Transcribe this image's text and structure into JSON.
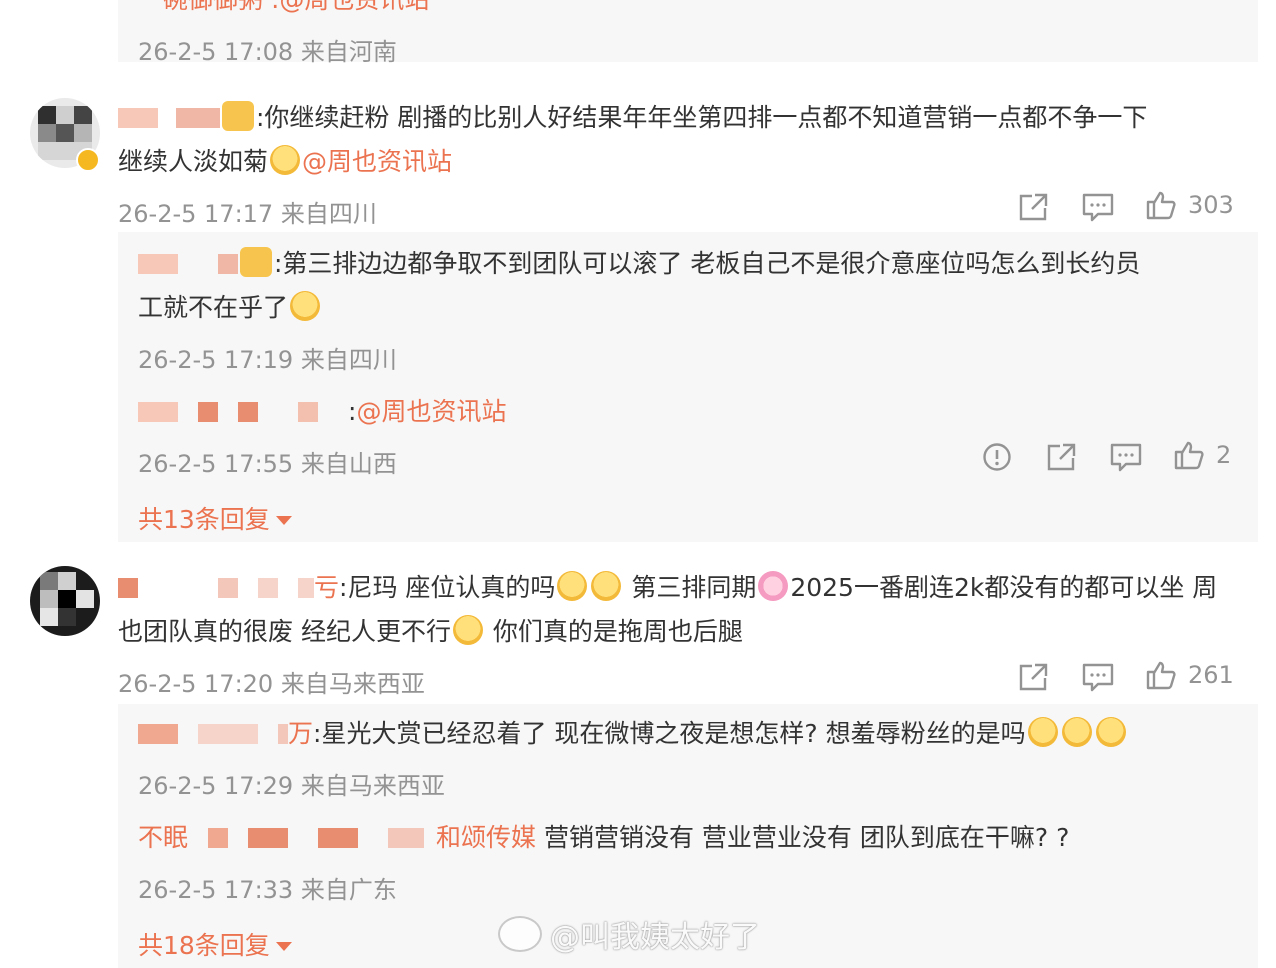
{
  "top_reply": {
    "text_partial": "一碗御御粥 :@周也资讯站",
    "meta": "26-2-5 17:08 来自河南"
  },
  "comments": [
    {
      "text": ":你继续赶粉 剧播的比别人好结果年年坐第四排一点都不知道营销一点都不争一下",
      "text_line2": "继续人淡如菊",
      "mention": "@周也资讯站",
      "meta": "26-2-5 17:17 来自四川",
      "likes": "303",
      "replies": [
        {
          "text": ":第三排边边都争取不到团队可以滚了 老板自己不是很介意座位吗怎么到长约员",
          "text_line2": "工就不在乎了",
          "meta": "26-2-5 17:19 来自四川"
        },
        {
          "text": ":",
          "mention": "@周也资讯站",
          "meta": "26-2-5 17:55 来自山西",
          "likes": "2"
        }
      ],
      "more_replies": "共13条回复"
    },
    {
      "text_prefix": "亏",
      "text": ":尼玛 座位认真的吗",
      "text_mid": " 第三排同期",
      "text_mid2": "2025一番剧连2k都没有的都可以坐 周",
      "text_line2": "也团队真的很废 经纪人更不行",
      "text_line2_end": " 你们真的是拖周也后腿",
      "meta": "26-2-5 17:20 来自马来西亚",
      "likes": "261",
      "replies": [
        {
          "text_prefix": "万",
          "text": ":星光大赏已经忍着了 现在微博之夜是想怎样? 想羞辱粉丝的是吗",
          "meta": "26-2-5 17:29 来自马来西亚"
        },
        {
          "text_prefix": "不眠",
          "mention": "和颂传媒",
          "text": " 营销营销没有 营业营业没有 团队到底在干嘛? ?",
          "meta": "26-2-5 17:33 来自广东"
        }
      ],
      "more_replies": "共18条回复"
    }
  ],
  "watermark": "@叫我姨太好了",
  "colors": {
    "accent": "#eb7350",
    "meta": "#939393",
    "rail": "#f7f7f7"
  },
  "icons": [
    "share-icon",
    "comment-icon",
    "like-icon",
    "report-icon",
    "dropdown-caret-icon"
  ]
}
